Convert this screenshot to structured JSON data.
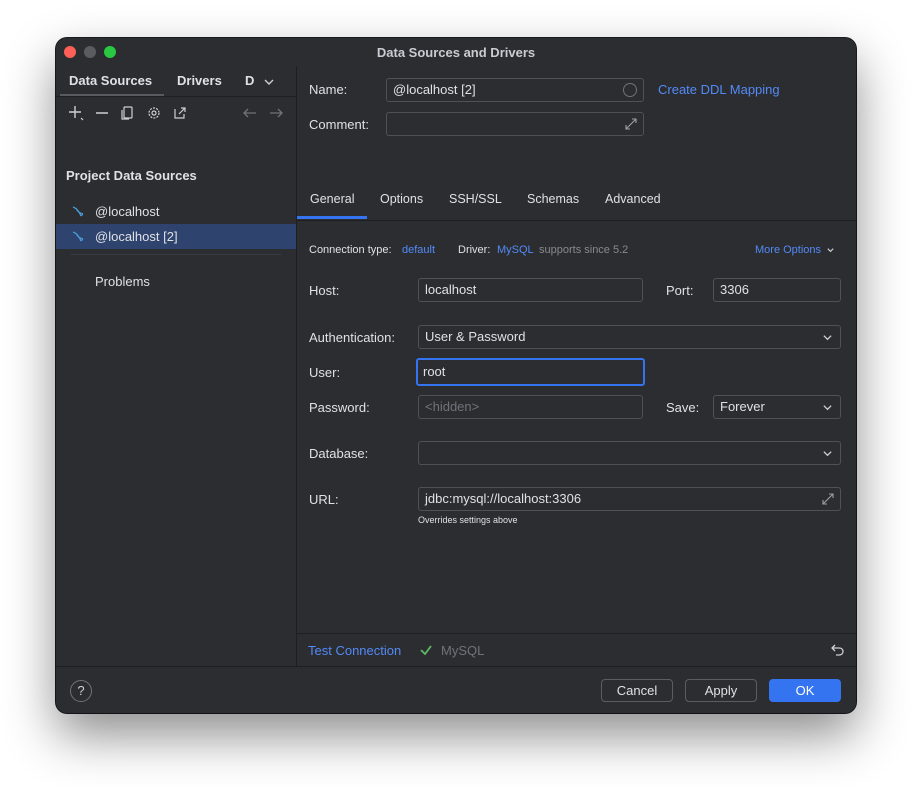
{
  "window": {
    "title": "Data Sources and Drivers"
  },
  "left_tabs": {
    "data_sources": "Data Sources",
    "drivers": "Drivers",
    "overflow": "D"
  },
  "sidebar": {
    "section_title": "Project Data Sources",
    "items": [
      {
        "label": "@localhost",
        "icon": "mysql-dolphin-icon",
        "selected": false
      },
      {
        "label": "@localhost [2]",
        "icon": "mysql-dolphin-icon",
        "selected": true
      }
    ],
    "problems_label": "Problems"
  },
  "form": {
    "name_label": "Name:",
    "name_value": "@localhost [2]",
    "create_ddl_link": "Create DDL Mapping",
    "comment_label": "Comment:",
    "comment_value": ""
  },
  "tabs": [
    "General",
    "Options",
    "SSH/SSL",
    "Schemas",
    "Advanced"
  ],
  "active_tab": "General",
  "general": {
    "conn_type_label": "Connection type:",
    "conn_type_value": "default",
    "driver_label": "Driver:",
    "driver_value": "MySQL",
    "driver_note": "supports since 5.2",
    "more_options": "More Options",
    "host_label": "Host:",
    "host_value": "localhost",
    "port_label": "Port:",
    "port_value": "3306",
    "auth_label": "Authentication:",
    "auth_value": "User & Password",
    "user_label": "User:",
    "user_value": "root",
    "password_label": "Password:",
    "password_placeholder": "<hidden>",
    "save_label": "Save:",
    "save_value": "Forever",
    "database_label": "Database:",
    "database_value": "",
    "url_label": "URL:",
    "url_value": "jdbc:mysql://localhost:3306",
    "url_hint": "Overrides settings above"
  },
  "test_connection": {
    "link": "Test Connection",
    "status_text": "MySQL"
  },
  "footer": {
    "cancel": "Cancel",
    "apply": "Apply",
    "ok": "OK",
    "help": "?"
  },
  "colors": {
    "accent": "#3574f0",
    "link": "#548af7",
    "selection": "#2e436e",
    "success": "#5fb865",
    "background": "#2b2d30"
  }
}
